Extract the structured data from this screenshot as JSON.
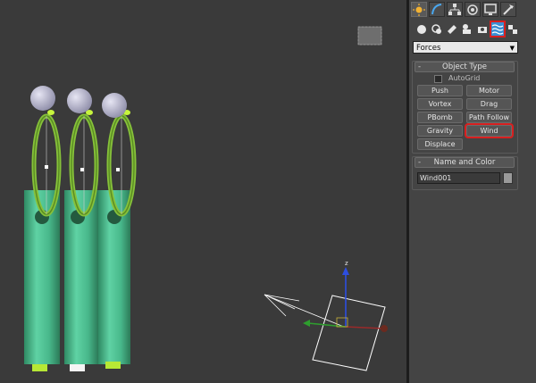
{
  "command_panel": {
    "tabs": [
      {
        "name": "create-tab-icon",
        "active": true
      },
      {
        "name": "modify-tab-icon",
        "active": false
      },
      {
        "name": "hierarchy-tab-icon",
        "active": false
      },
      {
        "name": "motion-tab-icon",
        "active": false
      },
      {
        "name": "display-tab-icon",
        "active": false
      },
      {
        "name": "utilities-tab-icon",
        "active": false
      }
    ],
    "subcategories": [
      {
        "name": "geometry-icon",
        "active": false
      },
      {
        "name": "shapes-icon",
        "active": false
      },
      {
        "name": "lights-icon",
        "active": false
      },
      {
        "name": "cameras-icon",
        "active": false
      },
      {
        "name": "helpers-icon",
        "active": false
      },
      {
        "name": "space-warps-icon",
        "active": true
      },
      {
        "name": "systems-icon",
        "active": false
      }
    ],
    "category_dropdown": "Forces",
    "object_type": {
      "title": "Object Type",
      "autogrid_label": "AutoGrid",
      "buttons": [
        "Push",
        "Motor",
        "Vortex",
        "Drag",
        "PBomb",
        "Path Follow",
        "Gravity",
        "Wind",
        "Displace"
      ],
      "highlighted": "Wind"
    },
    "name_and_color": {
      "title": "Name and Color",
      "name_value": "Wind001",
      "color": "#9a9a9a"
    }
  },
  "viewport": {
    "gizmo_axis_label": "z",
    "colors": {
      "background": "#3a3a3a",
      "cylinder": "#4fc79a",
      "ring": "#7fb43a",
      "sphere": "#c9c8de",
      "selection_highlight": "#d81f1f"
    }
  }
}
